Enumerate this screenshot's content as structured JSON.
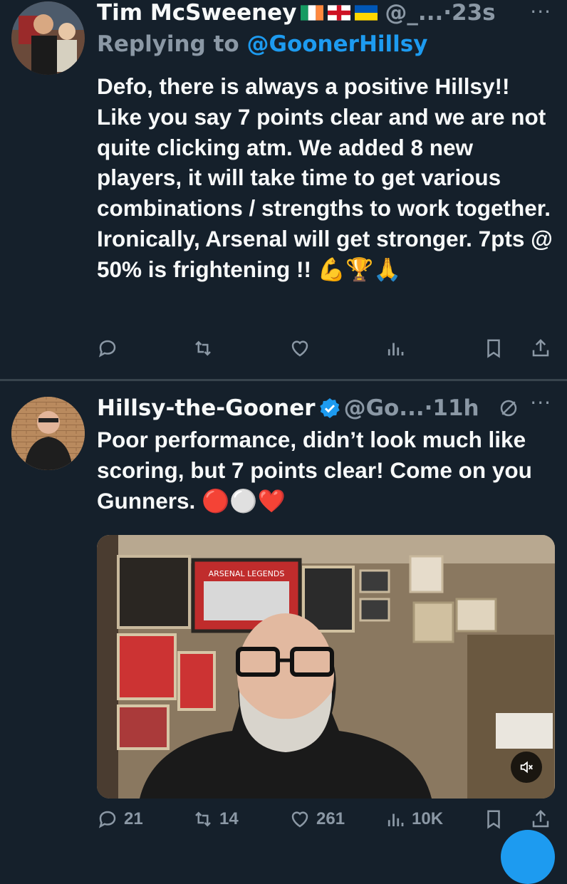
{
  "tweets": [
    {
      "name": "Tim McSweeney",
      "handle": "@_...",
      "time": "·23s",
      "replying_label": "Replying to ",
      "replying_to": "@GoonerHillsy",
      "text": "Defo, there is always a positive Hillsy!! Like you say 7 points clear and we are not quite clicking atm. We added 8 new players, it will take time to get various combinations / strengths to work together. Ironically, Arsenal will get stronger. 7pts @ 50% is frightening !! 💪🏆🙏",
      "flags": [
        "ireland-flag",
        "england-flag",
        "ukraine-flag"
      ],
      "more": "···"
    },
    {
      "name": "Hillsy-the-Gooner",
      "handle": "@Go...",
      "time": "·11h",
      "text": "Poor performance, didn’t look much like scoring, but 7 points clear!  Come on you Gunners. 🔴⚪❤️",
      "more": "···",
      "media_banner": "ARSENAL LEGENDS",
      "counts": {
        "replies": "21",
        "retweets": "14",
        "likes": "261",
        "views": "10K"
      }
    }
  ],
  "colors": {
    "background": "#15202b",
    "accent": "#1d9bf0",
    "muted": "#8b98a5"
  }
}
